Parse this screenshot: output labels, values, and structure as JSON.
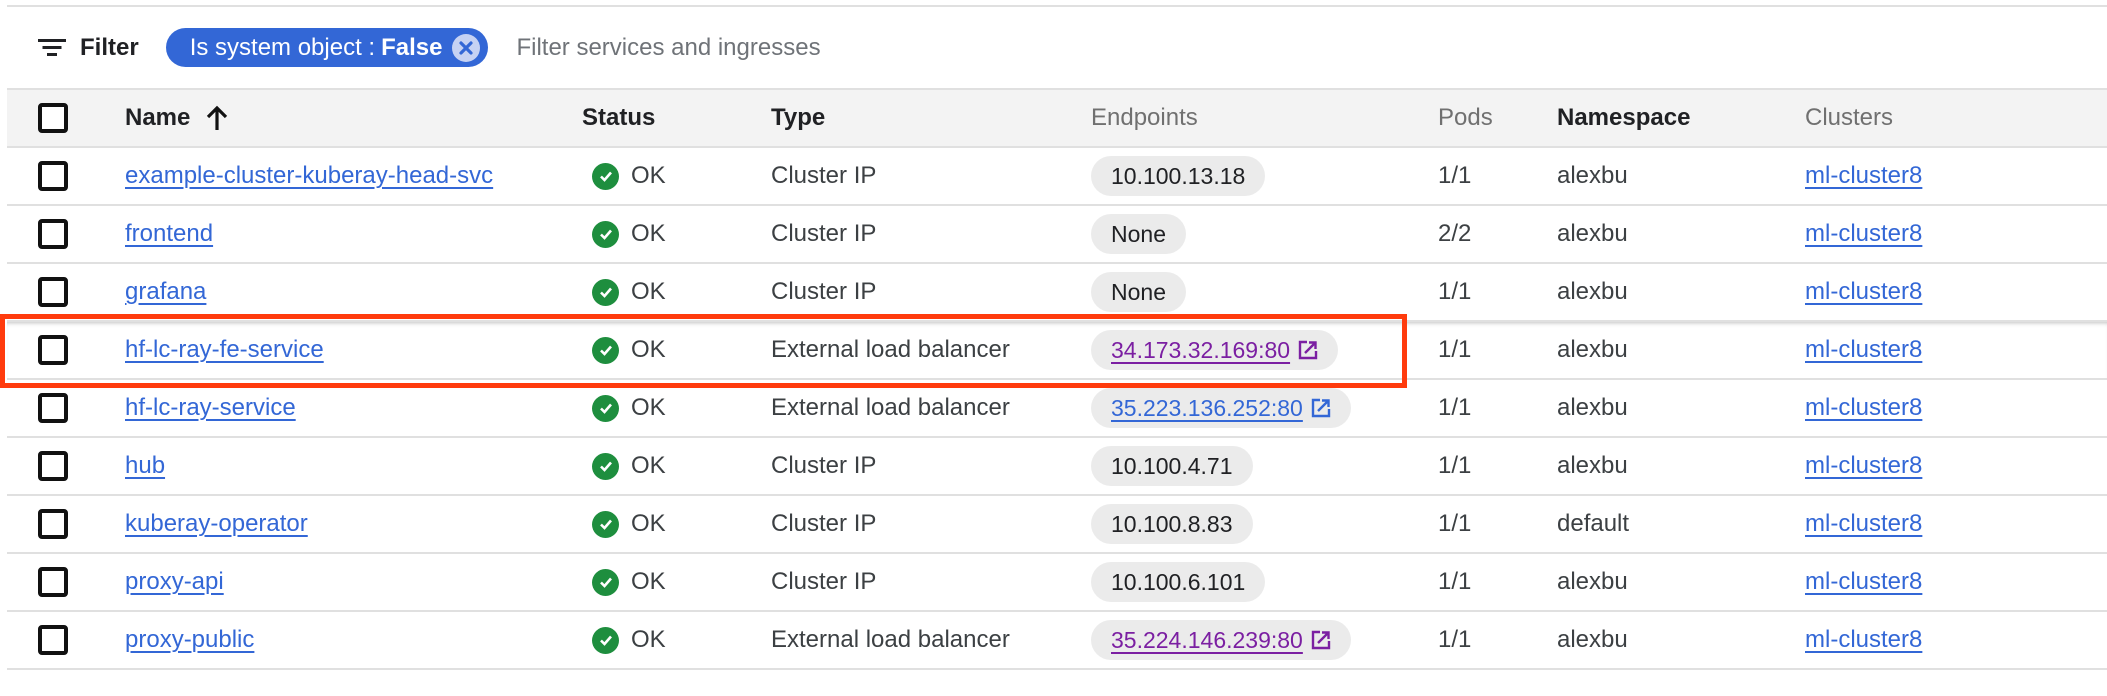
{
  "filter_bar": {
    "filter_label": "Filter",
    "icon": "filter-list-icon",
    "active_chip": {
      "key": "Is system object :",
      "value": "False",
      "close_icon": "cancel-icon"
    },
    "search_placeholder": "Filter services and ingresses",
    "search_value": ""
  },
  "table": {
    "columns": [
      {
        "label": "Name",
        "sort": "ascending",
        "sort_icon": "arrow-upward-icon"
      },
      {
        "label": "Status"
      },
      {
        "label": "Type"
      },
      {
        "label": "Endpoints"
      },
      {
        "label": "Pods"
      },
      {
        "label": "Namespace"
      },
      {
        "label": "Clusters"
      }
    ],
    "rows": [
      {
        "name": "example-cluster-kuberay-head-svc",
        "status": "OK",
        "type": "Cluster IP",
        "endpoint": "10.100.13.18",
        "endpoint_link": false,
        "pods": "1/1",
        "namespace": "alexbu",
        "cluster": "ml-cluster8"
      },
      {
        "name": "frontend",
        "status": "OK",
        "type": "Cluster IP",
        "endpoint": "None",
        "endpoint_link": false,
        "pods": "2/2",
        "namespace": "alexbu",
        "cluster": "ml-cluster8"
      },
      {
        "name": "grafana",
        "status": "OK",
        "type": "Cluster IP",
        "endpoint": "None",
        "endpoint_link": false,
        "pods": "1/1",
        "namespace": "alexbu",
        "cluster": "ml-cluster8"
      },
      {
        "name": "hf-lc-ray-fe-service",
        "status": "OK",
        "type": "External load balancer",
        "endpoint": "34.173.32.169:80",
        "endpoint_link": true,
        "visited": true,
        "highlighted": true,
        "pods": "1/1",
        "namespace": "alexbu",
        "cluster": "ml-cluster8"
      },
      {
        "name": "hf-lc-ray-service",
        "status": "OK",
        "type": "External load balancer",
        "endpoint": "35.223.136.252:80",
        "endpoint_link": true,
        "visited": false,
        "pods": "1/1",
        "namespace": "alexbu",
        "cluster": "ml-cluster8"
      },
      {
        "name": "hub",
        "status": "OK",
        "type": "Cluster IP",
        "endpoint": "10.100.4.71",
        "endpoint_link": false,
        "pods": "1/1",
        "namespace": "alexbu",
        "cluster": "ml-cluster8"
      },
      {
        "name": "kuberay-operator",
        "status": "OK",
        "type": "Cluster IP",
        "endpoint": "10.100.8.83",
        "endpoint_link": false,
        "pods": "1/1",
        "namespace": "default",
        "cluster": "ml-cluster8"
      },
      {
        "name": "proxy-api",
        "status": "OK",
        "type": "Cluster IP",
        "endpoint": "10.100.6.101",
        "endpoint_link": false,
        "pods": "1/1",
        "namespace": "alexbu",
        "cluster": "ml-cluster8"
      },
      {
        "name": "proxy-public",
        "status": "OK",
        "type": "External load balancer",
        "endpoint": "35.224.146.239:80",
        "endpoint_link": true,
        "visited": true,
        "pods": "1/1",
        "namespace": "alexbu",
        "cluster": "ml-cluster8"
      }
    ]
  },
  "colors": {
    "chip_bg": "#3367d6",
    "link": "#3367d6",
    "visited_link": "#7b1fa2",
    "status_ok": "#1e8e3e",
    "highlight_box": "#ff3b0d"
  }
}
